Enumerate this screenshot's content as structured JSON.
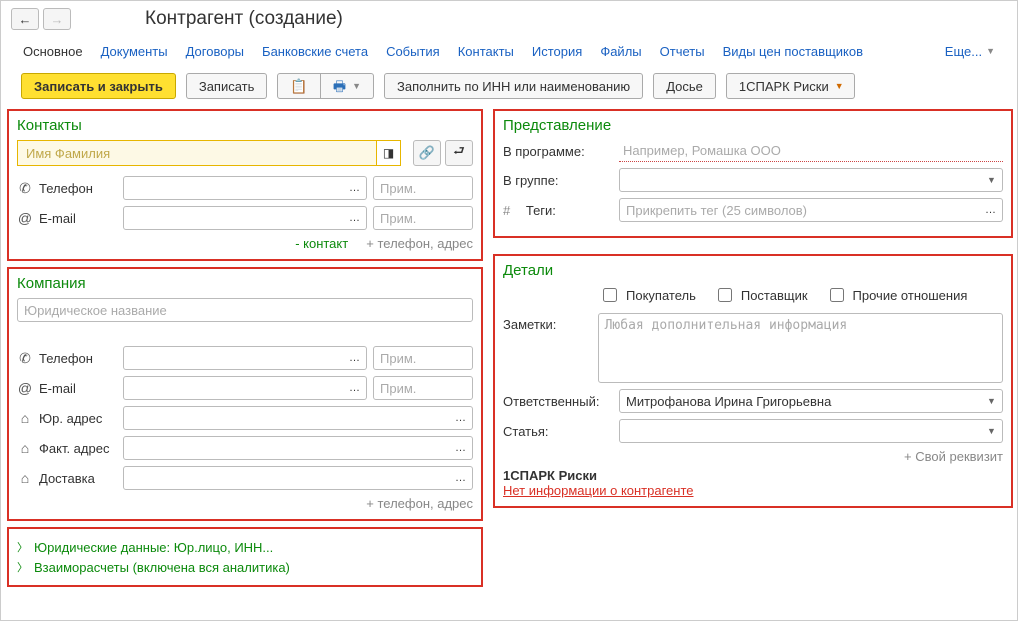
{
  "header": {
    "title": "Контрагент (создание)"
  },
  "tabs": {
    "main": "Основное",
    "docs": "Документы",
    "contracts": "Договоры",
    "bank": "Банковские счета",
    "events": "События",
    "contacts": "Контакты",
    "history": "История",
    "files": "Файлы",
    "reports": "Отчеты",
    "price_types": "Виды цен поставщиков",
    "more": "Еще..."
  },
  "toolbar": {
    "save_close": "Записать и закрыть",
    "save": "Записать",
    "fill_by_inn": "Заполнить по ИНН или наименованию",
    "dossier": "Досье",
    "spark": "1СПАРК Риски"
  },
  "contacts": {
    "title": "Контакты",
    "name_placeholder": "Имя Фамилия",
    "phone_label": "Телефон",
    "note_placeholder": "Прим.",
    "email_label": "E-mail",
    "remove_contact": "- контакт",
    "add_phone_addr": "+ телефон, адрес"
  },
  "company": {
    "title": "Компания",
    "name_placeholder": "Юридическое название",
    "phone_label": "Телефон",
    "email_label": "E-mail",
    "jur_addr_label": "Юр. адрес",
    "fact_addr_label": "Факт. адрес",
    "delivery_label": "Доставка",
    "note_placeholder": "Прим.",
    "add_phone_addr": "+ телефон, адрес"
  },
  "collapsible": {
    "legal": "Юридические данные: Юр.лицо, ИНН...",
    "settlements": "Взаиморасчеты (включена вся аналитика)"
  },
  "representation": {
    "title": "Представление",
    "in_program_label": "В программе:",
    "in_program_placeholder": "Например, Ромашка ООО",
    "in_group_label": "В группе:",
    "tags_label": "Теги:",
    "tags_placeholder": "Прикрепить тег (25 символов)"
  },
  "details": {
    "title": "Детали",
    "buyer": "Покупатель",
    "supplier": "Поставщик",
    "other": "Прочие отношения",
    "notes_label": "Заметки:",
    "notes_placeholder": "Любая дополнительная информация",
    "responsible_label": "Ответственный:",
    "responsible_value": "Митрофанова Ирина Григорьевна",
    "article_label": "Статья:",
    "add_req": "+ Свой реквизит",
    "spark_title": "1СПАРК Риски",
    "spark_warn": "Нет информации о контрагенте"
  }
}
